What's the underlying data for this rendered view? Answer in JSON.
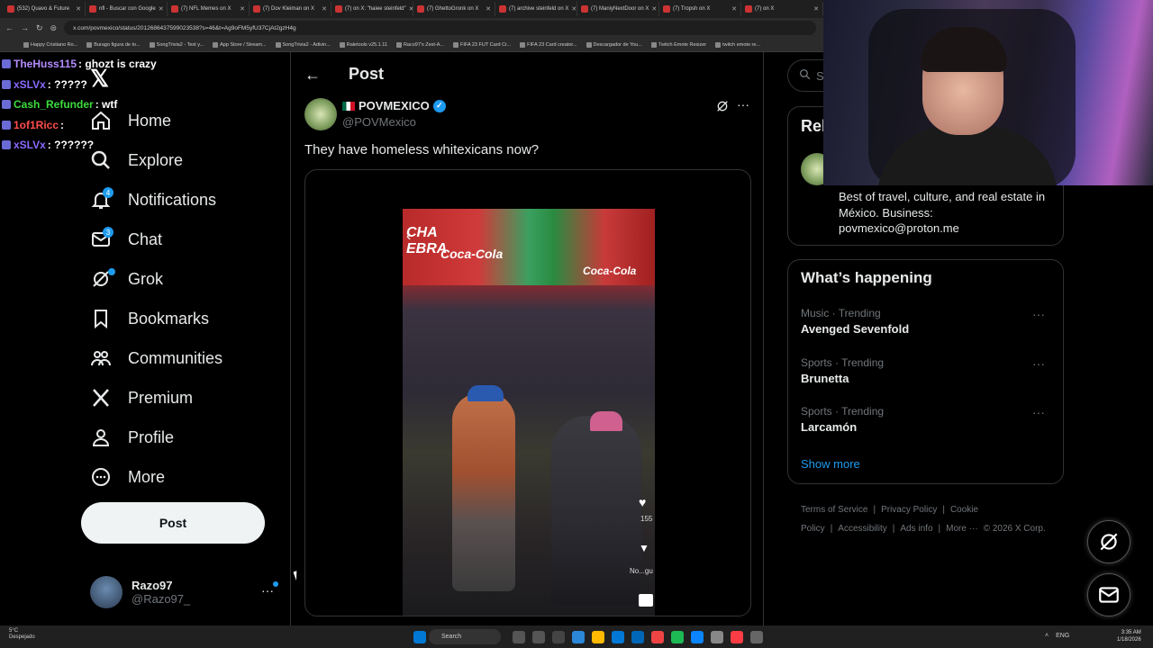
{
  "browser": {
    "tabs": [
      "(532) Quavo & Future",
      "nfl - Buscar con Google",
      "(7) NFL Memes on X",
      "(7) Dov Kleiman on X",
      "(7) on X: \"haiee steinfeld\"",
      "(7) GhettoGronk on X",
      "(7) archive steinfeld on X",
      "(7) ManiyNextDoor on X",
      "(7) Tropsh on X",
      "(7) on X"
    ],
    "url": "x.com/povmexico/status/2012686437599023538?s=46&t=Ag9oFM5yfU37CjAt2gzH4g",
    "bookmarks": [
      "Happy Cristiano Ro...",
      "Burago figura de to...",
      "SongTrivia2 - Test y...",
      "App Store / Stream...",
      "SongTrivia2 - Adivin...",
      "Raletools v25.1.11",
      "Raco97's Zest-A...",
      "FIFA 23 FUT Card Cr...",
      "FIFA 23 Card creator...",
      "Descargador de You...",
      "Twitch Emote Resizer",
      "twitch emote re..."
    ]
  },
  "chat": [
    {
      "user": "TheHuss115",
      "msg": ": ghozt is crazy",
      "color": "#b58cff"
    },
    {
      "user": "xSLVx",
      "msg": ": ?????",
      "color": "#8a6bff"
    },
    {
      "user": "Cash_Refunder",
      "msg": ": wtf",
      "color": "#3ddc3d"
    },
    {
      "user": "1of1Ricc",
      "msg": ":",
      "color": "#ff4d4d"
    },
    {
      "user": "xSLVx",
      "msg": ": ??????",
      "color": "#8a6bff"
    }
  ],
  "sidebar": {
    "logo": "𝕏",
    "items": [
      {
        "label": "Home",
        "icon": "home-icon"
      },
      {
        "label": "Explore",
        "icon": "search-icon"
      },
      {
        "label": "Notifications",
        "icon": "bell-icon",
        "badge": "4"
      },
      {
        "label": "Chat",
        "icon": "mail-icon",
        "badge": "3"
      },
      {
        "label": "Grok",
        "icon": "grok-icon",
        "badge": ""
      },
      {
        "label": "Bookmarks",
        "icon": "bookmark-icon"
      },
      {
        "label": "Communities",
        "icon": "communities-icon"
      },
      {
        "label": "Premium",
        "icon": "x-icon"
      },
      {
        "label": "Profile",
        "icon": "profile-icon"
      },
      {
        "label": "More",
        "icon": "more-icon"
      }
    ],
    "post_label": "Post",
    "user": {
      "name": "Razo97",
      "handle": "@Razo97_"
    }
  },
  "post": {
    "header": "Post",
    "author_name": "POVMEXICO",
    "author_handle": "@POVMexico",
    "text": "They have homeless whitexicans now?",
    "video_overlay": {
      "likes": "155",
      "dislike_label": "No...gu"
    },
    "sign_text": {
      "left": "CHA\nEBRA",
      "mid": "Coca-Cola",
      "right": "Coca-Cola"
    }
  },
  "right": {
    "search_placeholder": "Se",
    "relevant_title": "Rel",
    "bio": "Best of travel, culture, and real estate in México. Business: povmexico@proton.me",
    "happening_title": "What’s happening",
    "trends": [
      {
        "meta": "Music · Trending",
        "name": "Avenged Sevenfold"
      },
      {
        "meta": "Sports · Trending",
        "name": "Brunetta"
      },
      {
        "meta": "Sports · Trending",
        "name": "Larcamón"
      }
    ],
    "show_more": "Show more",
    "footer": [
      "Terms of Service",
      "|",
      "Privacy Policy",
      "|",
      "Cookie Policy",
      "|",
      "Accessibility",
      "|",
      "Ads info",
      "|",
      "More ···",
      "© 2026 X Corp."
    ]
  },
  "taskbar": {
    "weather_temp": "5°C",
    "weather_desc": "Despejado",
    "search": "Search",
    "lang": "ENG",
    "time": "3:35 AM",
    "date": "1/18/2026"
  },
  "colors": {
    "accent": "#1d9bf0",
    "bg": "#000000",
    "border": "#2f3336",
    "muted": "#71767b"
  }
}
